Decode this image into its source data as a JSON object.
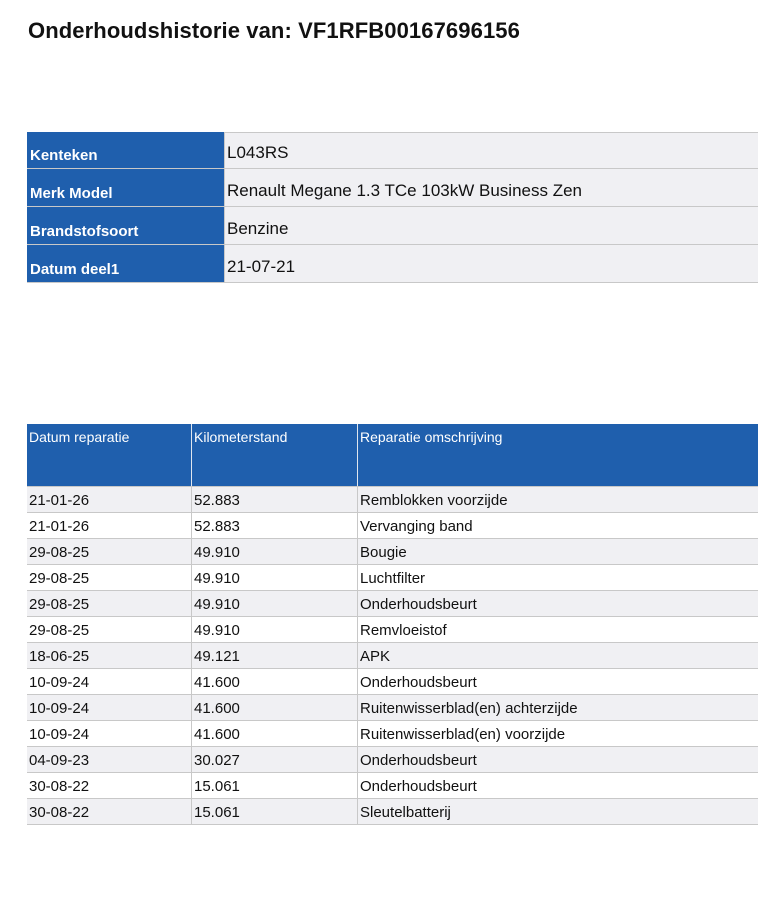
{
  "title": "Onderhoudshistorie van: VF1RFB00167696156",
  "vehicle": [
    {
      "label": "Kenteken",
      "value": "L043RS"
    },
    {
      "label": "Merk Model",
      "value": "Renault Megane 1.3 TCe 103kW Business Zen"
    },
    {
      "label": "Brandstofsoort",
      "value": "Benzine"
    },
    {
      "label": "Datum deel1",
      "value": "21-07-21"
    }
  ],
  "repairs": {
    "headers": [
      "Datum reparatie",
      "Kilometerstand",
      "Reparatie omschrijving"
    ],
    "rows": [
      [
        "21-01-26",
        "52.883",
        "Remblokken voorzijde"
      ],
      [
        "21-01-26",
        "52.883",
        "Vervanging band"
      ],
      [
        "29-08-25",
        "49.910",
        "Bougie"
      ],
      [
        "29-08-25",
        "49.910",
        "Luchtfilter"
      ],
      [
        "29-08-25",
        "49.910",
        "Onderhoudsbeurt"
      ],
      [
        "29-08-25",
        "49.910",
        "Remvloeistof"
      ],
      [
        "18-06-25",
        "49.121",
        "APK"
      ],
      [
        "10-09-24",
        "41.600",
        "Onderhoudsbeurt"
      ],
      [
        "10-09-24",
        "41.600",
        "Ruitenwisserblad(en) achterzijde"
      ],
      [
        "10-09-24",
        "41.600",
        "Ruitenwisserblad(en) voorzijde"
      ],
      [
        "04-09-23",
        "30.027",
        "Onderhoudsbeurt"
      ],
      [
        "30-08-22",
        "15.061",
        "Onderhoudsbeurt"
      ],
      [
        "30-08-22",
        "15.061",
        "Sleutelbatterij"
      ]
    ]
  },
  "colors": {
    "header_blue": "#1f5fad",
    "row_shade": "#f0f0f3"
  }
}
